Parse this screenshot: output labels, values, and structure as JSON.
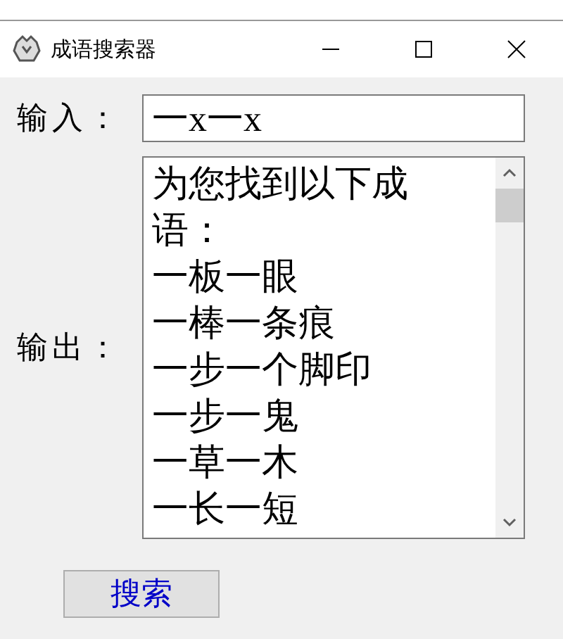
{
  "window": {
    "title": "成语搜索器"
  },
  "input": {
    "label": "输入：",
    "value": "一x一x"
  },
  "output": {
    "label": "输出：",
    "lines": [
      "为您找到以下成语：",
      "一板一眼",
      "一棒一条痕",
      "一步一个脚印",
      "一步一鬼",
      "一草一木",
      "一长一短"
    ]
  },
  "buttons": [
    {
      "label": "搜索"
    }
  ]
}
